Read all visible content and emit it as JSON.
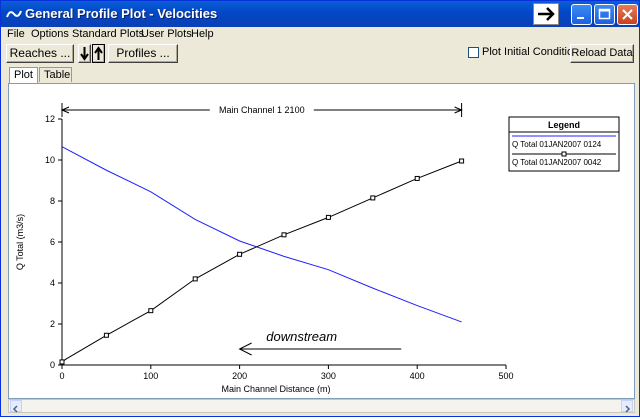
{
  "window": {
    "title": "General Profile Plot - Velocities"
  },
  "menu": [
    "File",
    "Options",
    "Standard Plots",
    "User Plots",
    "Help"
  ],
  "toolbar": {
    "reaches_label": "Reaches ...",
    "profiles_label": "Profiles ...",
    "plot_initial_label": "Plot Initial Conditions",
    "plot_initial_checked": false,
    "reload_label": "Reload Data"
  },
  "tabs": [
    "Plot",
    "Table"
  ],
  "active_tab": "Plot",
  "chart_data": {
    "type": "line",
    "reach_label": "Main Channel 1 2100",
    "reach_extent": [
      0,
      450
    ],
    "xlabel": "Main Channel Distance (m)",
    "ylabel": "Q Total (m3/s)",
    "xlim": [
      0,
      500
    ],
    "ylim": [
      0,
      12
    ],
    "xticks": [
      0,
      100,
      200,
      300,
      400,
      500
    ],
    "yticks": [
      0,
      2,
      4,
      6,
      8,
      10,
      12
    ],
    "grid": false,
    "annotation": "downstream",
    "legend": {
      "title": "Legend",
      "position": "right"
    },
    "series": [
      {
        "name": "Q Total 01JAN2007 0124",
        "color": "#2020ff",
        "marker": "none",
        "x": [
          0,
          50,
          100,
          150,
          200,
          250,
          300,
          350,
          400,
          450
        ],
        "y": [
          10.65,
          9.5,
          8.45,
          7.1,
          6.05,
          5.3,
          4.65,
          3.75,
          2.9,
          2.1
        ]
      },
      {
        "name": "Q Total 01JAN2007 0042",
        "color": "#000000",
        "marker": "square",
        "x": [
          0,
          5,
          50,
          100,
          150,
          200,
          250,
          300,
          350,
          400,
          450
        ],
        "y": [
          0.15,
          0.3,
          1.45,
          2.65,
          4.2,
          5.4,
          6.35,
          7.2,
          8.15,
          9.1,
          9.95
        ]
      }
    ]
  }
}
